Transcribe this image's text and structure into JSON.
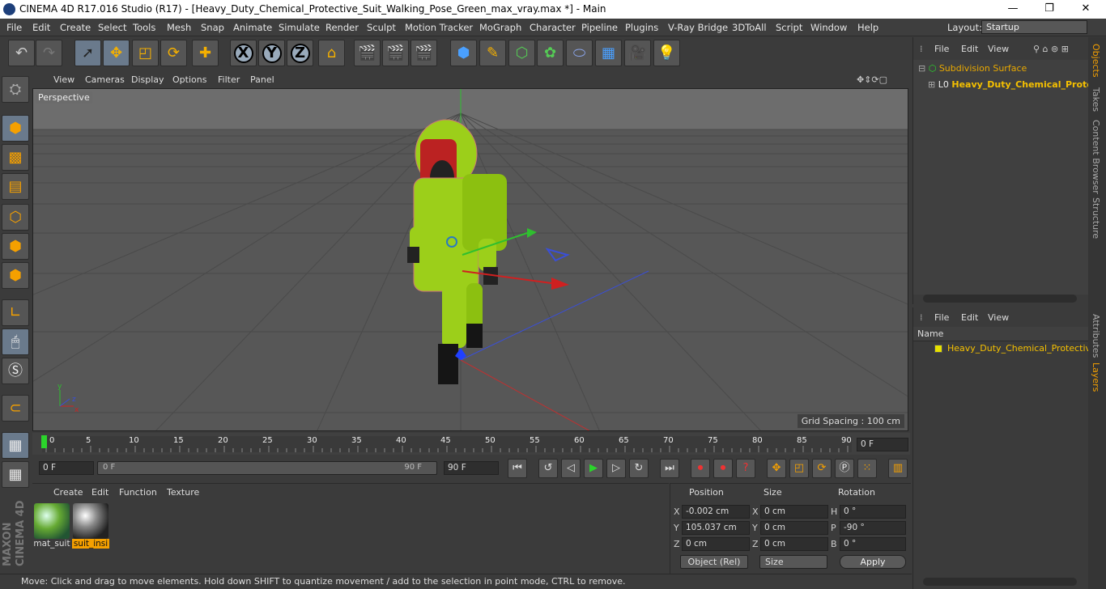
{
  "title": "CINEMA 4D R17.016 Studio (R17) - [Heavy_Duty_Chemical_Protective_Suit_Walking_Pose_Green_max_vray.max *] - Main",
  "window_controls": {
    "minimize": "—",
    "maximize": "❐",
    "close": "✕"
  },
  "menu": [
    "File",
    "Edit",
    "Create",
    "Select",
    "Tools",
    "Mesh",
    "Snap",
    "Animate",
    "Simulate",
    "Render",
    "Sculpt",
    "Motion Tracker",
    "MoGraph",
    "Character",
    "Pipeline",
    "Plugins",
    "V-Ray Bridge",
    "3DToAll",
    "Script",
    "Window",
    "Help"
  ],
  "layout": {
    "label": "Layout:",
    "value": "Startup"
  },
  "toolbar": {
    "axis_x": "X",
    "axis_y": "Y",
    "axis_z": "Z"
  },
  "viewport_menu": [
    "View",
    "Cameras",
    "Display",
    "Options",
    "Filter",
    "Panel"
  ],
  "viewport": {
    "label": "Perspective",
    "grid_spacing": "Grid Spacing : 100 cm"
  },
  "timeline": {
    "ticks": [
      "0",
      "5",
      "10",
      "15",
      "20",
      "25",
      "30",
      "35",
      "40",
      "45",
      "50",
      "55",
      "60",
      "65",
      "70",
      "75",
      "80",
      "85",
      "90"
    ],
    "current_frame": "0 F"
  },
  "time_controls": {
    "start": "0 F",
    "slider_start": "0 F",
    "slider_end": "90 F",
    "end": "90 F"
  },
  "material_menu": [
    "Create",
    "Edit",
    "Function",
    "Texture"
  ],
  "materials": [
    {
      "name": "mat_suit",
      "selected": false
    },
    {
      "name": "suit_insi",
      "selected": true
    }
  ],
  "coords": {
    "headers": {
      "position": "Position",
      "size": "Size",
      "rotation": "Rotation"
    },
    "rows": [
      {
        "axis": "X",
        "pos": "-0.002 cm",
        "size_axis": "X",
        "size": "0 cm",
        "rot_axis": "H",
        "rot": "0 °"
      },
      {
        "axis": "Y",
        "pos": "105.037 cm",
        "size_axis": "Y",
        "size": "0 cm",
        "rot_axis": "P",
        "rot": "-90 °"
      },
      {
        "axis": "Z",
        "pos": "0 cm",
        "size_axis": "Z",
        "size": "0 cm",
        "rot_axis": "B",
        "rot": "0 °"
      }
    ],
    "mode": "Object (Rel)",
    "size_mode": "Size",
    "apply": "Apply"
  },
  "status": "Move: Click and drag to move elements. Hold down SHIFT to quantize movement / add to the selection in point mode, CTRL to remove.",
  "objects_menu": [
    "File",
    "Edit",
    "View"
  ],
  "objects": [
    {
      "name": "Subdivision Surface"
    },
    {
      "name": "Heavy_Duty_Chemical_Protective_"
    }
  ],
  "layers_menu": [
    "File",
    "Edit",
    "View"
  ],
  "layers_header": "Name",
  "layers": [
    {
      "name": "Heavy_Duty_Chemical_Protective_S",
      "color": "#e6e000"
    }
  ],
  "side_tabs": [
    "Objects",
    "Takes",
    "Content Browser",
    "Structure",
    "Attributes",
    "Layers"
  ],
  "brand": {
    "maxon": "MAXON",
    "c4d": "CINEMA 4D"
  },
  "colors": {
    "accent": "#f5a000",
    "suit": "#9ccf1a"
  }
}
